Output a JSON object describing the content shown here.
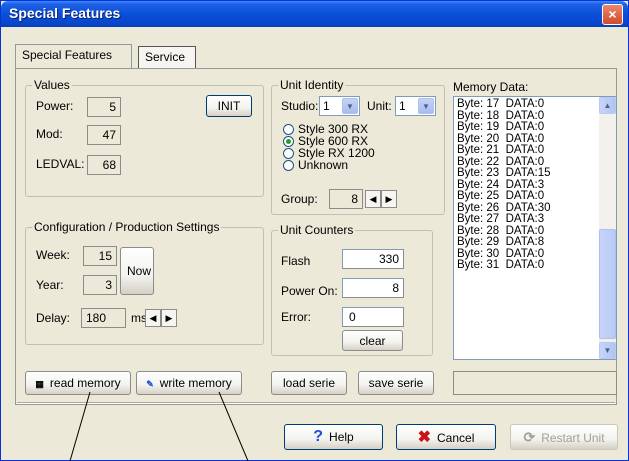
{
  "window": {
    "title": "Special Features",
    "close_icon": "×"
  },
  "tabs": [
    {
      "label": "Special Features"
    },
    {
      "label": "Service"
    }
  ],
  "values": {
    "title": "Values",
    "power_label": "Power:",
    "power": "5",
    "mod_label": "Mod:",
    "mod": "47",
    "ledval_label": "LEDVAL:",
    "ledval": "68",
    "init_label": "INIT"
  },
  "config": {
    "title": "Configuration / Production Settings",
    "week_label": "Week:",
    "week": "15",
    "year_label": "Year:",
    "year": "3",
    "now_label": "Now",
    "delay_label": "Delay:",
    "delay": "180",
    "delay_unit": "ms"
  },
  "unit_identity": {
    "title": "Unit Identity",
    "studio_label": "Studio:",
    "studio": "1",
    "unit_label": "Unit:",
    "unit": "1",
    "styles": [
      "Style 300 RX",
      "Style 600 RX",
      "Style RX 1200",
      "Unknown"
    ],
    "selected_style_index": 1,
    "group_label": "Group:",
    "group": "8"
  },
  "unit_counters": {
    "title": "Unit Counters",
    "flash_label": "Flash",
    "flash": "330",
    "power_on_label": "Power On:",
    "power_on": "8",
    "error_label": "Error:",
    "error": "0",
    "clear_label": "clear"
  },
  "memory": {
    "title": "Memory Data:",
    "items": [
      "Byte: 17  DATA:0",
      "Byte: 18  DATA:0",
      "Byte: 19  DATA:0",
      "Byte: 20  DATA:0",
      "Byte: 21  DATA:0",
      "Byte: 22  DATA:0",
      "Byte: 23  DATA:15",
      "Byte: 24  DATA:3",
      "Byte: 25  DATA:0",
      "Byte: 26  DATA:30",
      "Byte: 27  DATA:3",
      "Byte: 28  DATA:0",
      "Byte: 29  DATA:8",
      "Byte: 30  DATA:0",
      "Byte: 31  DATA:0"
    ]
  },
  "actions": {
    "read_memory": "read memory",
    "write_memory": "write memory",
    "load_serie": "load serie",
    "save_serie": "save serie"
  },
  "footer": {
    "help": "Help",
    "cancel": "Cancel",
    "restart_unit": "Restart Unit"
  },
  "colors": {
    "titlebar": "#0a4fd8",
    "window_bg": "#ece9d8",
    "help_icon": "#1f4fd8",
    "cancel_icon": "#c81414"
  }
}
